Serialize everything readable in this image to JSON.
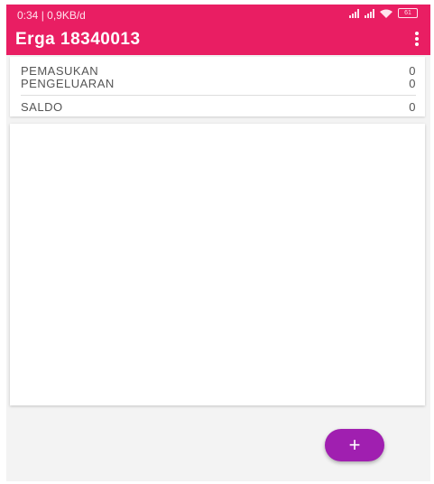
{
  "status_bar": {
    "left_text": "0:34 | 0,9KB/d",
    "battery": "61"
  },
  "appbar": {
    "title": "Erga 18340013"
  },
  "summary": {
    "rows": [
      {
        "label": "PEMASUKAN",
        "value": "0"
      },
      {
        "label": "PENGELUARAN",
        "value": "0"
      }
    ],
    "balance": {
      "label": "SALDO",
      "value": "0"
    }
  },
  "fab": {
    "label": "+"
  },
  "colors": {
    "primary": "#e91e63",
    "fab": "#a01fb0"
  }
}
